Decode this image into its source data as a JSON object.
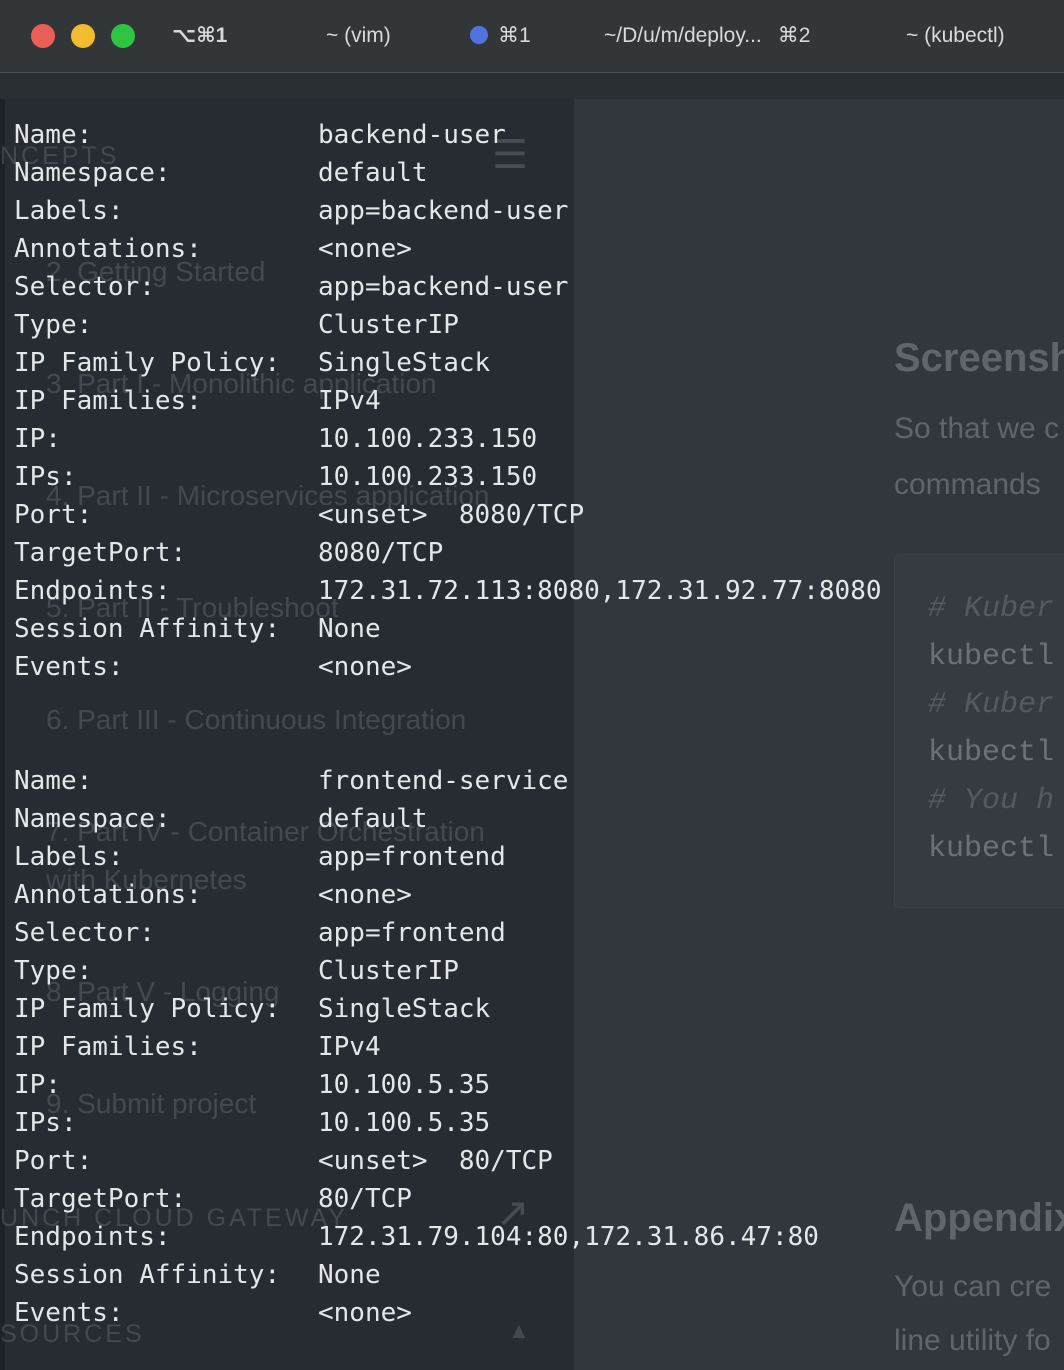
{
  "titlebar": {
    "active_tab": "⌥⌘1",
    "tabs": [
      {
        "label": "~ (vim)",
        "shortcut": ""
      },
      {
        "label": "⌘1",
        "shortcut": ""
      },
      {
        "label": "~/D/u/m/deploy...",
        "shortcut": "⌘2"
      },
      {
        "label": "~ (kubectl)",
        "shortcut": ""
      }
    ]
  },
  "background": {
    "nav_items": [
      "NCEPTS",
      "2. Getting Started",
      "3. Part I - Monolithic application",
      "4. Part II - Microservices application",
      "5. Part II - Troubleshoot",
      "6. Part III - Continuous Integration",
      "7. Part IV - Container Orchestration",
      "with Kubernetes",
      "8. Part V - Logging",
      "9. Submit project",
      "UNCH CLOUD GATEWAY",
      "SOURCES"
    ],
    "content": {
      "heading1": "Screensh",
      "para1_line1": "So that we c",
      "para1_line2": "commands",
      "code_lines": [
        "# Kuber",
        "kubectl",
        "# Kuber",
        "kubectl",
        "# You h",
        "kubectl"
      ],
      "heading2": "Appendix",
      "para2_line1": "You can cre",
      "para2_line2": "line utility fo"
    }
  },
  "services": [
    {
      "fields": [
        {
          "key": "Name:",
          "value": "backend-user"
        },
        {
          "key": "Namespace:",
          "value": "default"
        },
        {
          "key": "Labels:",
          "value": "app=backend-user"
        },
        {
          "key": "Annotations:",
          "value": "<none>"
        },
        {
          "key": "Selector:",
          "value": "app=backend-user"
        },
        {
          "key": "Type:",
          "value": "ClusterIP"
        },
        {
          "key": "IP Family Policy:",
          "value": "SingleStack"
        },
        {
          "key": "IP Families:",
          "value": "IPv4"
        },
        {
          "key": "IP:",
          "value": "10.100.233.150"
        },
        {
          "key": "IPs:",
          "value": "10.100.233.150"
        },
        {
          "key": "Port:",
          "value": "<unset>  8080/TCP"
        },
        {
          "key": "TargetPort:",
          "value": "8080/TCP"
        },
        {
          "key": "Endpoints:",
          "value": "172.31.72.113:8080,172.31.92.77:8080"
        },
        {
          "key": "Session Affinity:",
          "value": "None"
        },
        {
          "key": "Events:",
          "value": "<none>"
        }
      ]
    },
    {
      "fields": [
        {
          "key": "Name:",
          "value": "frontend-service"
        },
        {
          "key": "Namespace:",
          "value": "default"
        },
        {
          "key": "Labels:",
          "value": "app=frontend"
        },
        {
          "key": "Annotations:",
          "value": "<none>"
        },
        {
          "key": "Selector:",
          "value": "app=frontend"
        },
        {
          "key": "Type:",
          "value": "ClusterIP"
        },
        {
          "key": "IP Family Policy:",
          "value": "SingleStack"
        },
        {
          "key": "IP Families:",
          "value": "IPv4"
        },
        {
          "key": "IP:",
          "value": "10.100.5.35"
        },
        {
          "key": "IPs:",
          "value": "10.100.5.35"
        },
        {
          "key": "Port:",
          "value": "<unset>  80/TCP"
        },
        {
          "key": "TargetPort:",
          "value": "80/TCP"
        },
        {
          "key": "Endpoints:",
          "value": "172.31.79.104:80,172.31.86.47:80"
        },
        {
          "key": "Session Affinity:",
          "value": "None"
        },
        {
          "key": "Events:",
          "value": "<none>"
        }
      ]
    }
  ]
}
